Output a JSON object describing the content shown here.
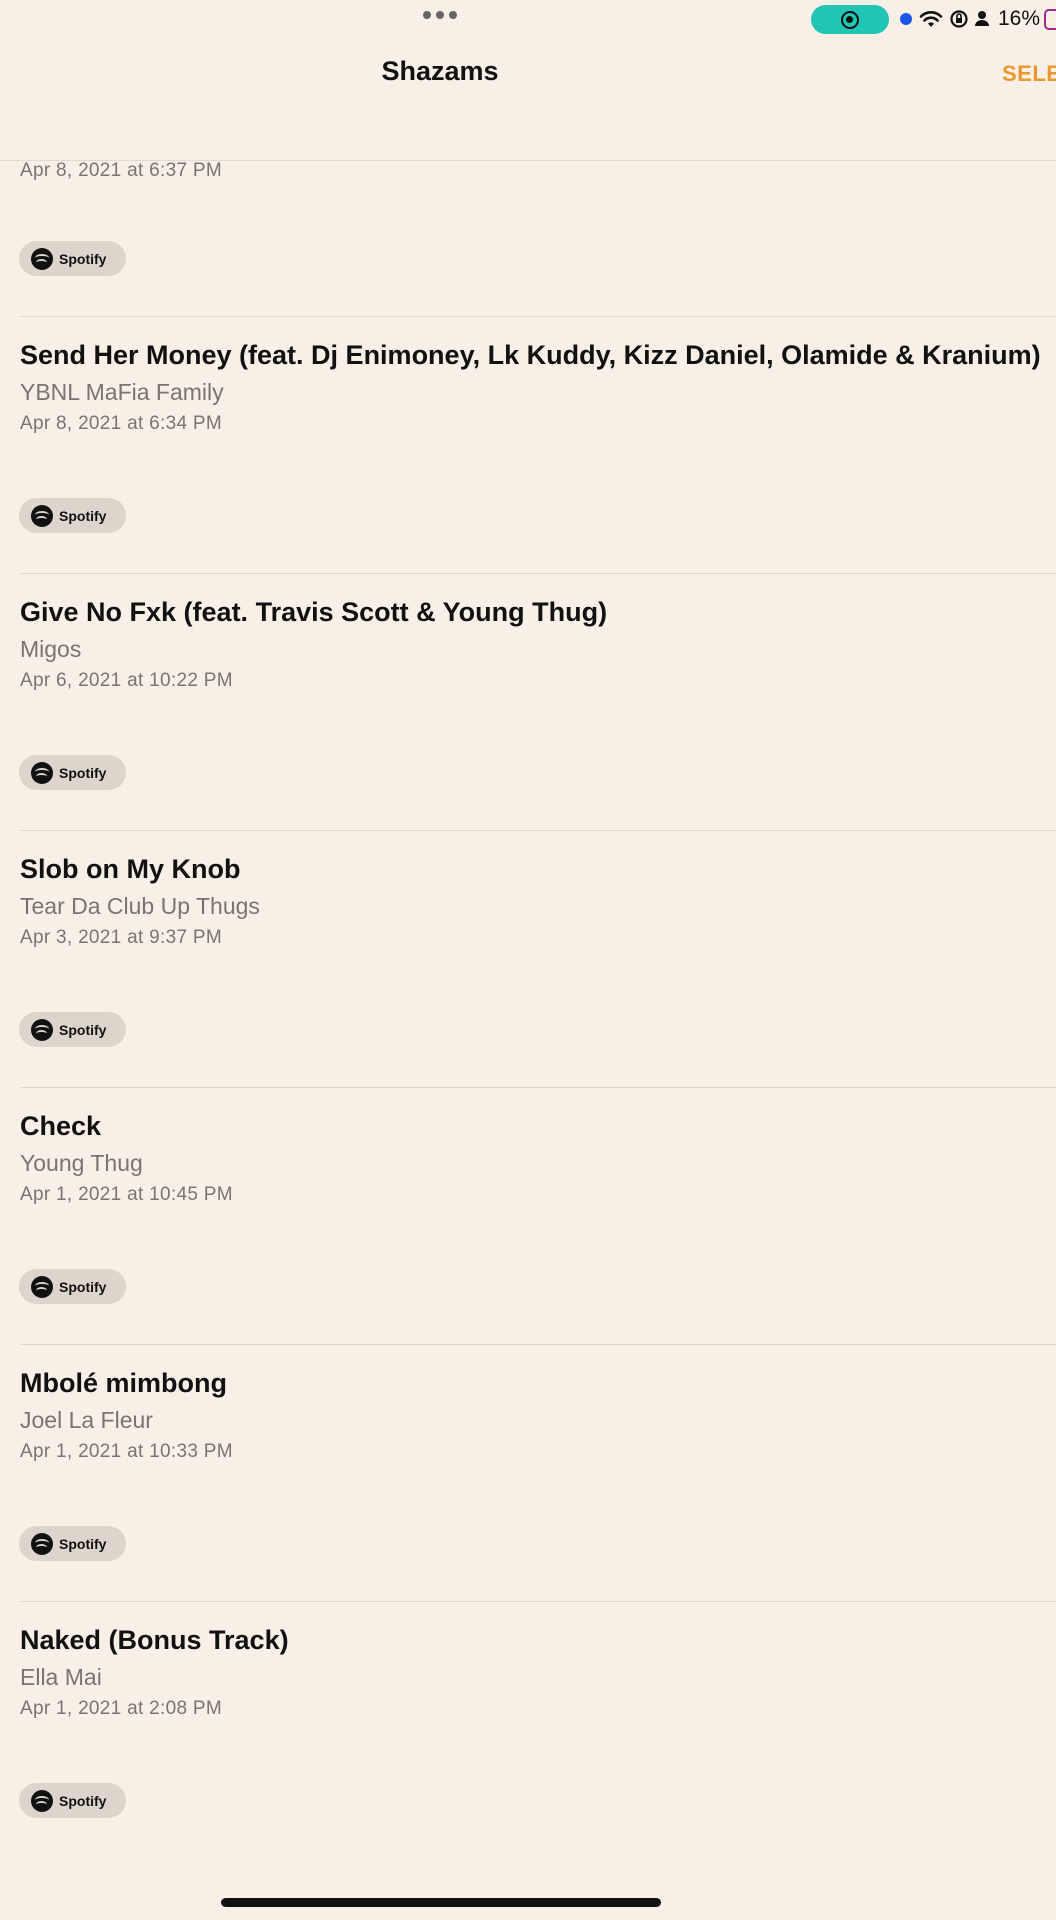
{
  "status_bar": {
    "battery": "16%",
    "icons": [
      "wifi-icon",
      "screen-lock-rotation-icon",
      "person-icon",
      "battery-icon",
      "screen-recording-icon"
    ]
  },
  "nav": {
    "title": "Shazams",
    "select_label": "SELE"
  },
  "partial_item": {
    "date": "Apr 8, 2021 at 6:37 PM",
    "button": "Spotify"
  },
  "items": [
    {
      "title": "Send Her Money (feat. Dj Enimoney, Lk Kuddy, Kizz Daniel, Olamide & Kranium)",
      "artist": "YBNL MaFia Family",
      "date": "Apr 8, 2021 at 6:34 PM",
      "button": "Spotify"
    },
    {
      "title": "Give No Fxk (feat. Travis Scott & Young Thug)",
      "artist": "Migos",
      "date": "Apr 6, 2021 at 10:22 PM",
      "button": "Spotify"
    },
    {
      "title": "Slob on My Knob",
      "artist": "Tear Da Club Up Thugs",
      "date": "Apr 3, 2021 at 9:37 PM",
      "button": "Spotify"
    },
    {
      "title": "Check",
      "artist": "Young Thug",
      "date": "Apr 1, 2021 at 10:45 PM",
      "button": "Spotify"
    },
    {
      "title": "Mbolé mimbong",
      "artist": "Joel La Fleur",
      "date": "Apr 1, 2021 at 10:33 PM",
      "button": "Spotify"
    },
    {
      "title": "Naked (Bonus Track)",
      "artist": "Ella Mai",
      "date": "Apr 1, 2021 at 2:08 PM",
      "button": "Spotify"
    }
  ]
}
